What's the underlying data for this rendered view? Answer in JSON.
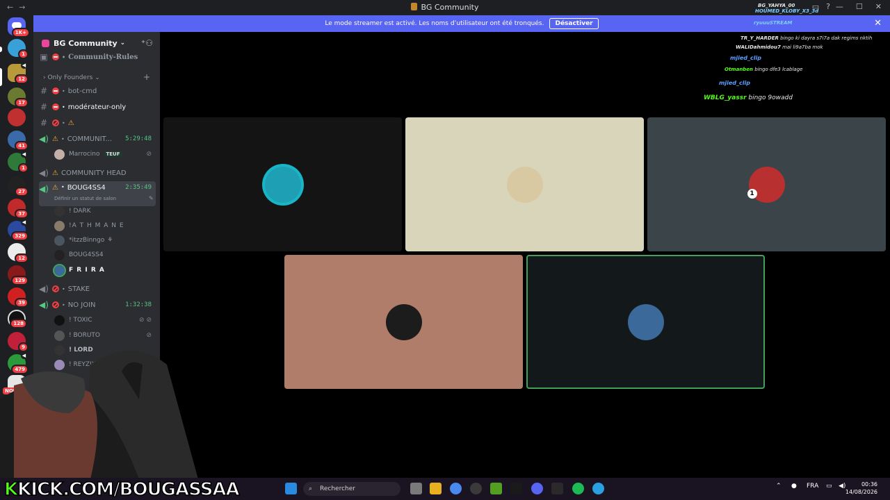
{
  "window": {
    "title": "BG Community"
  },
  "banner": {
    "text": "Le mode streamer est activé. Les noms d’utilisateur ont été tronqués.",
    "button": "Désactiver"
  },
  "rail": {
    "home_badge": "1K+",
    "badges": [
      "1",
      "12",
      "17",
      "41",
      "1",
      "27",
      "37",
      "329",
      "12",
      "129",
      "39",
      "128",
      "9",
      "479"
    ],
    "new_label": "NOUVEAU"
  },
  "server": {
    "name": "BG Community"
  },
  "channels": {
    "rules": "Community-Rules",
    "category": "Only Founders",
    "bot_cmd": "bot-cmd",
    "moderator": "modérateur-only",
    "warn_only": "",
    "community": "COMMUNIT...",
    "community_timer": "5:29:48",
    "community_head": "COMMUNITY HEAD",
    "boug": "BOUG4SS4",
    "boug_timer": "2:35:49",
    "boug_status": "Définir un statut de salon",
    "stake": "STAKE",
    "nojoin": "NO JOIN",
    "nojoin_timer": "1:32:38"
  },
  "users": {
    "marrocino": "Marrocino",
    "teuf_tag": "TEUF",
    "dark": "! DARK",
    "athmane": "!A T H M A N E",
    "itzz": "*itzzBinngo",
    "boug": "BOUG4SS4",
    "frira": "F R I R A",
    "toxic": "! TOXIC",
    "boruto": "! BORUTO",
    "lord": "! LORD",
    "reyzix": "! REYZIX"
  },
  "chat": [
    {
      "name": "BG_YAHYA_00",
      "msg": ""
    },
    {
      "name": "HOUMED_KLOBY_X3_3d",
      "msg": ""
    },
    {
      "name": "ryuuuSTREAM",
      "msg": ""
    },
    {
      "name": "TR_Y_HARDER",
      "msg": "bingo ki dayra s7i7a dak regims nktih"
    },
    {
      "name": "WALIDahmidou7",
      "msg": "mai li9a7ba mok"
    },
    {
      "name": "mjied_clip",
      "msg": ""
    },
    {
      "name": "Otmanben",
      "msg": "bingo dfe3 lcablage"
    },
    {
      "name": "mjied_clip",
      "msg": ""
    },
    {
      "name": "WBLG_yassr",
      "msg": "bingo 9owadd"
    }
  ],
  "tiles": [
    {
      "bg": "#141414",
      "avatar": "#1f9fb3"
    },
    {
      "bg": "#d8d5bb",
      "avatar": "#d9c9a3"
    },
    {
      "bg": "#3a4449",
      "avatar": "#b83030"
    },
    {
      "bg": "#b07d6a",
      "avatar": "#1c1c1c"
    },
    {
      "bg": "#13191b",
      "avatar": "#3b6a9a"
    }
  ],
  "taskbar": {
    "overlay": "KICK.COM/BOUGASSAA",
    "overlay_k": "K",
    "search": "Rechercher",
    "lang": "FRA",
    "time": "00:36",
    "date": "14/08/2026"
  },
  "colors": {
    "blurple": "#5865f2",
    "speaking": "#43a25a",
    "kick": "#53fc18"
  }
}
